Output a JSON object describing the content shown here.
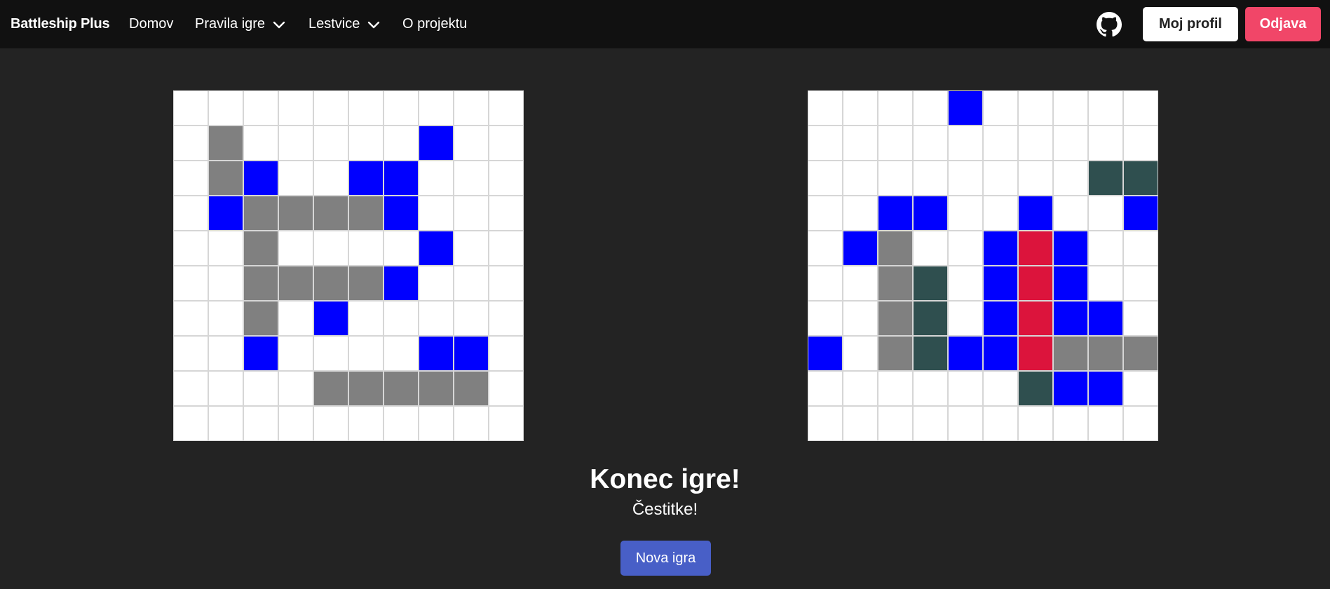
{
  "navbar": {
    "brand": "Battleship Plus",
    "items": [
      {
        "label": "Domov"
      },
      {
        "label": "Pravila igre",
        "icon": "chevron-down-icon"
      },
      {
        "label": "Lestvice",
        "icon": "chevron-down-icon"
      },
      {
        "label": "O projektu"
      }
    ],
    "github_icon": "github-icon",
    "profile_label": "Moj profil",
    "logout_label": "Odjava"
  },
  "colors": {
    "background": "#232323",
    "navbar": "#111111",
    "empty": "#ffffff",
    "miss": "#0000ff",
    "ship": "#808080",
    "hit": "#2f4f4f",
    "sunk": "#dc143c",
    "logout": "#f14668",
    "new_game": "#485fc7"
  },
  "legend": {
    "E": "empty",
    "M": "miss",
    "S": "ship",
    "H": "hit",
    "X": "sunk"
  },
  "boards": {
    "player": [
      "EEEEEEEEEE",
      "ESEEEEEMEE",
      "ESMEEMMEEE",
      "EMSSSSMEEE",
      "EESEEEEMEE",
      "EESSSSMEEE",
      "EESEMEEEEE",
      "EEMEEEEMME",
      "EEEESSSSSE",
      "EEEEEEEEEE"
    ],
    "opponent": [
      "EEEEMEEEEE",
      "EEEEEEEEEE",
      "EEEEEEEEHH",
      "EEMMEEMEEM",
      "EMSEEMXMEE",
      "EESHEMXMEE",
      "EESHEMXMME",
      "MESHMMXSSS",
      "EEEEEEHMME",
      "EEEEEEEEEE"
    ]
  },
  "result": {
    "title": "Konec igre!",
    "subtitle": "Čestitke!",
    "new_game_label": "Nova igra"
  }
}
